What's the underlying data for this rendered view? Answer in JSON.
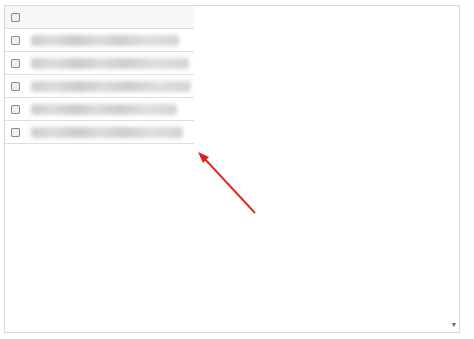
{
  "grid": {
    "header": {
      "select_all_checked": false
    },
    "rows": [
      {
        "text": "",
        "checked": false
      },
      {
        "text": "",
        "checked": false
      },
      {
        "text": "",
        "checked": false
      },
      {
        "text": "",
        "checked": false
      },
      {
        "text": "",
        "checked": false
      }
    ]
  },
  "scrollbar": {
    "down_arrow_glyph": "▼"
  },
  "annotation": {
    "color": "#e02020"
  }
}
